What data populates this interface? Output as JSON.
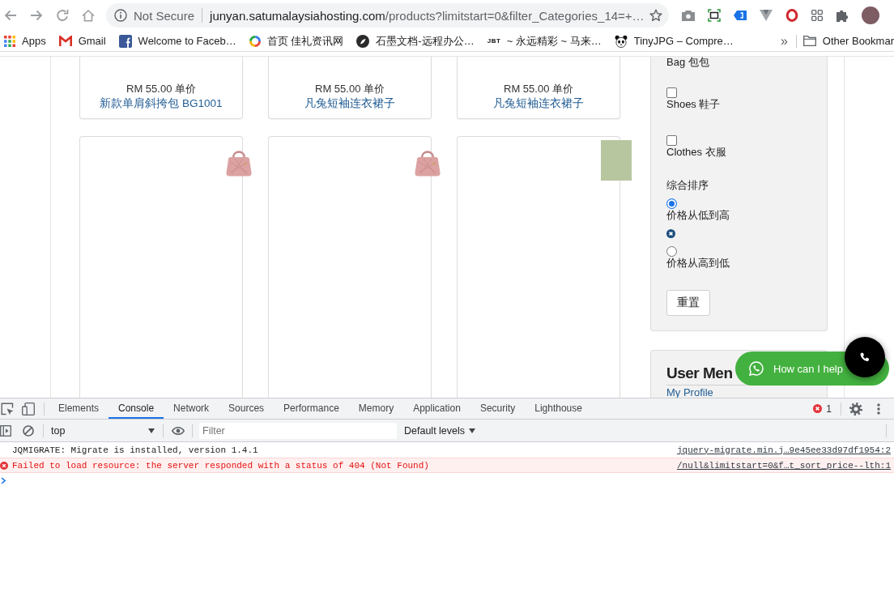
{
  "browser": {
    "address": {
      "security": "Not Secure",
      "host": "junyan.satumalaysiahosting.com",
      "path": "/products?limitstart=0&filter_Categories_14=+…"
    },
    "bookmarks": [
      {
        "kind": "apps",
        "label": "Apps"
      },
      {
        "kind": "mail",
        "label": "Gmail"
      },
      {
        "kind": "square",
        "label": "Welcome to Faceb…"
      },
      {
        "kind": "ring",
        "label": "首页 佳礼资讯网"
      },
      {
        "kind": "disc",
        "label": "石墨文档-远程办公…"
      },
      {
        "kind": "badge",
        "logo": "JBT",
        "label": "~ 永远精彩 ~ 马来…"
      },
      {
        "kind": "panda",
        "label": "TinyJPG – Compre…"
      }
    ],
    "overflow": "»",
    "other_bookmarks": "Other Bookmar"
  },
  "page": {
    "products_top": [
      {
        "price": "RM 55.00 单价",
        "name": "新款单肩斜挎包 BG1001"
      },
      {
        "price": "RM 55.00 单价",
        "name": "凡兔短袖连衣裙子"
      },
      {
        "price": "RM 55.00 单价",
        "name": "凡兔短袖连衣裙子"
      }
    ],
    "products_next": [
      {
        "kind": "handbag"
      },
      {
        "kind": "handbag"
      },
      {
        "kind": "photo"
      }
    ],
    "filter": {
      "cut_label": "Bag 包包",
      "categories": [
        {
          "label": "Shoes 鞋子",
          "checked": false
        },
        {
          "label": "Clothes 衣服",
          "checked": false
        }
      ],
      "sort_title": "综合排序",
      "sort_options": [
        {
          "label": "价格从低到高",
          "selected": true
        },
        {
          "label": "价格从高到低",
          "selected": false
        }
      ],
      "reset": "重置"
    },
    "user_menu": {
      "title": "User Men",
      "links": [
        "My Profile"
      ]
    },
    "chat": {
      "label": "How can I help"
    }
  },
  "devtools": {
    "tabs": [
      {
        "label": "Elements",
        "selected": false
      },
      {
        "label": "Console",
        "selected": true
      },
      {
        "label": "Network",
        "selected": false
      },
      {
        "label": "Sources",
        "selected": false
      },
      {
        "label": "Performance",
        "selected": false
      },
      {
        "label": "Memory",
        "selected": false
      },
      {
        "label": "Application",
        "selected": false
      },
      {
        "label": "Security",
        "selected": false
      },
      {
        "label": "Lighthouse",
        "selected": false
      }
    ],
    "error_count": "1",
    "context": "top",
    "filter_placeholder": "Filter",
    "levels": "Default levels",
    "messages": [
      {
        "kind": "log",
        "text": "JQMIGRATE: Migrate is installed, version 1.4.1",
        "source": "jquery-migrate.min.j…9e45ee33d97df1954:2"
      },
      {
        "kind": "error",
        "text": "Failed to load resource: the server responded with a status of 404 (Not Found)",
        "source": "/null&limitstart=0&f…t_sort_price--lth:1"
      }
    ]
  }
}
